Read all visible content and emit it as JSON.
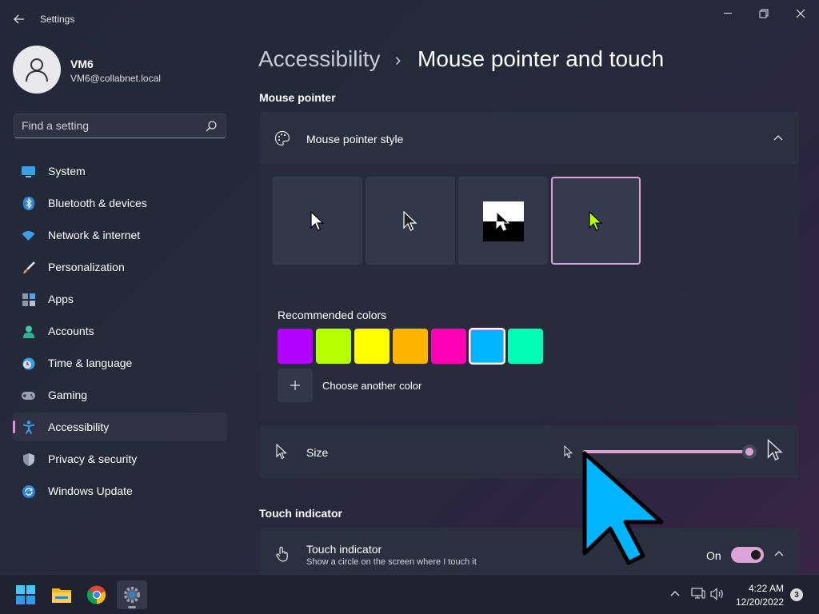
{
  "window": {
    "title": "Settings"
  },
  "user": {
    "name": "VM6",
    "email": "VM6@collabnet.local"
  },
  "search": {
    "placeholder": "Find a setting"
  },
  "sidebar": {
    "items": [
      {
        "label": "System",
        "icon": "system-icon"
      },
      {
        "label": "Bluetooth & devices",
        "icon": "bluetooth-icon"
      },
      {
        "label": "Network & internet",
        "icon": "wifi-icon"
      },
      {
        "label": "Personalization",
        "icon": "brush-icon"
      },
      {
        "label": "Apps",
        "icon": "apps-icon"
      },
      {
        "label": "Accounts",
        "icon": "accounts-icon"
      },
      {
        "label": "Time & language",
        "icon": "time-language-icon"
      },
      {
        "label": "Gaming",
        "icon": "gamepad-icon"
      },
      {
        "label": "Accessibility",
        "icon": "accessibility-icon",
        "active": true
      },
      {
        "label": "Privacy & security",
        "icon": "shield-icon"
      },
      {
        "label": "Windows Update",
        "icon": "update-icon"
      }
    ]
  },
  "breadcrumb": {
    "parent": "Accessibility",
    "separator": "›",
    "current": "Mouse pointer and touch"
  },
  "mouse_pointer_section": {
    "title": "Mouse pointer",
    "style_card": {
      "label": "Mouse pointer style",
      "styles": [
        "White",
        "Black",
        "Inverted",
        "Custom"
      ],
      "selected_style": "Custom"
    },
    "recommended_colors": {
      "label": "Recommended colors",
      "colors": [
        "#b400ff",
        "#b4ff00",
        "#ffff00",
        "#ffb400",
        "#ff00b4",
        "#00b4ff",
        "#00ffb4"
      ],
      "selected_color": "#00b4ff",
      "choose_another_label": "Choose another color"
    },
    "size": {
      "label": "Size",
      "value_fraction": 1.0
    }
  },
  "touch_section": {
    "title": "Touch indicator",
    "card": {
      "label": "Touch indicator",
      "description": "Show a circle on the screen where I touch it",
      "state_label": "On",
      "enabled": true
    }
  },
  "taskbar": {
    "time": "4:22 AM",
    "date": "12/20/2022",
    "notification_count": "3",
    "apps": [
      "start-icon",
      "file-explorer-icon",
      "chrome-icon",
      "settings-icon"
    ]
  },
  "colors": {
    "accent": "#dca3d6",
    "cursor_color": "#00b4ff"
  }
}
